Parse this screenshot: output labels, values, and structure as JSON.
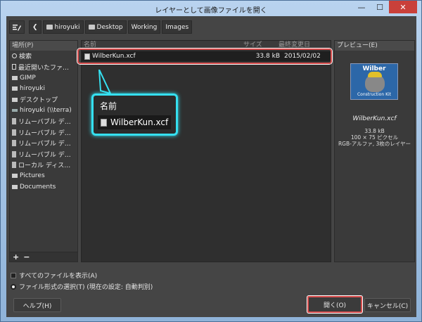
{
  "window": {
    "title": "レイヤーとして画像ファイルを開く",
    "minimize": "—",
    "maximize": "☐",
    "close": "✕"
  },
  "pathbar": {
    "crumbs": [
      "hiroyuki",
      "Desktop",
      "Working",
      "Images"
    ]
  },
  "places": {
    "header": "場所(P)",
    "items": [
      {
        "label": "検索",
        "icon": "search-icon"
      },
      {
        "label": "最近開いたファ…",
        "icon": "recent-icon"
      },
      {
        "label": "GIMP",
        "icon": "folder-icon"
      },
      {
        "label": "hiroyuki",
        "icon": "folder-icon"
      },
      {
        "label": "デスクトップ",
        "icon": "folder-icon"
      },
      {
        "label": "hiroyuki (\\\\terra)",
        "icon": "network-drive-icon"
      },
      {
        "label": "リムーバブル デ…",
        "icon": "drive-icon"
      },
      {
        "label": "リムーバブル デ…",
        "icon": "drive-icon"
      },
      {
        "label": "リムーバブル デ…",
        "icon": "drive-icon"
      },
      {
        "label": "リムーバブル デ…",
        "icon": "drive-icon"
      },
      {
        "label": "ローカル ディス…",
        "icon": "drive-icon"
      },
      {
        "label": "Pictures",
        "icon": "folder-icon"
      },
      {
        "label": "Documents",
        "icon": "folder-icon"
      }
    ],
    "add": "+",
    "remove": "−"
  },
  "files": {
    "col_name": "名前",
    "col_size": "サイズ",
    "col_modified": "最終変更日",
    "rows": [
      {
        "name": "WilberKun.xcf",
        "size": "33.8 kB",
        "modified": "2015/02/02"
      }
    ]
  },
  "preview": {
    "header": "プレビュー(E)",
    "thumb_title": "Wilber",
    "thumb_sub": "Construction Kit",
    "filename": "WilberKun.xcf",
    "info_size": "33.8 kB",
    "info_dims": "100 × 75 ピクセル",
    "info_type": "RGB-アルファ, 3枚のレイヤー"
  },
  "options": {
    "show_all": "すべてのファイルを表示(A)",
    "select_type": "ファイル形式の選択(T) (現在の設定: 自動判別)"
  },
  "buttons": {
    "help": "ヘルプ(H)",
    "open": "開く(O)",
    "cancel": "キャンセル(C)"
  },
  "callout": {
    "title": "名前",
    "filename": "WilberKun.xcf"
  },
  "colors": {
    "highlight": "#d64b4b",
    "callout_border": "#35e0f0"
  }
}
